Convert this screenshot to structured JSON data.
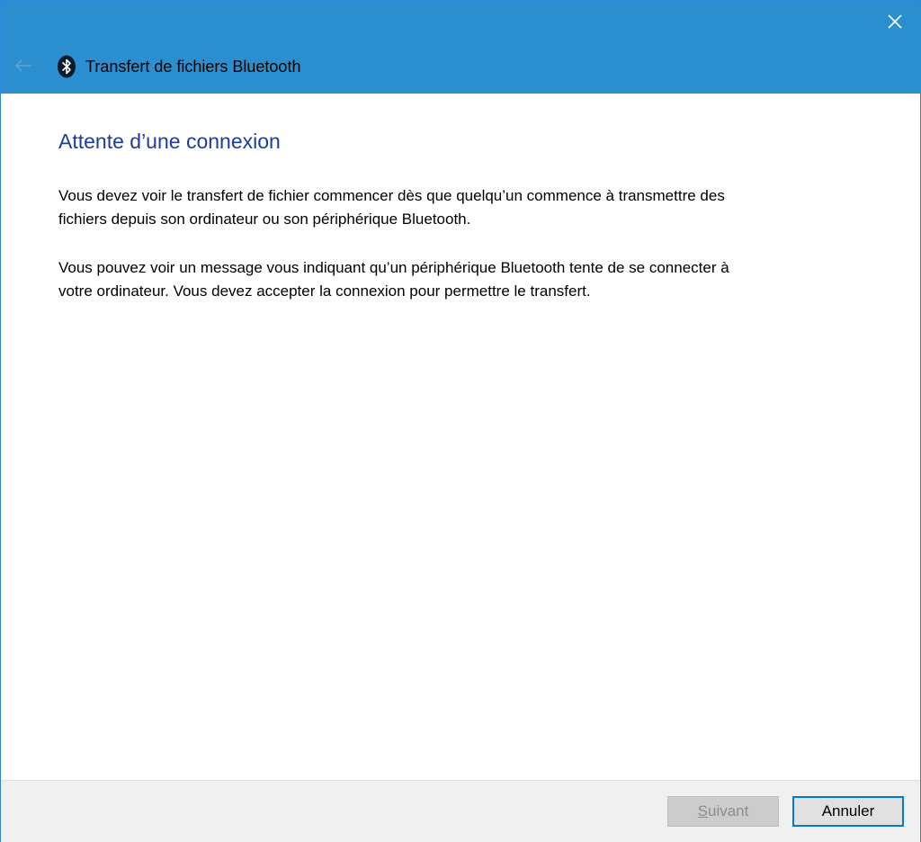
{
  "window": {
    "title": "Transfert de fichiers Bluetooth",
    "accent_color": "#2b8fcf",
    "close_icon": "close-icon",
    "back_icon": "back-arrow-icon",
    "app_icon": "bluetooth-icon"
  },
  "main": {
    "heading": "Attente d’une connexion",
    "paragraph1": "Vous devez voir le transfert de fichier commencer dès que quelqu’un commence à transmettre des fichiers depuis son ordinateur ou son périphérique Bluetooth.",
    "paragraph2": "Vous pouvez voir un message vous indiquant qu’un périphérique Bluetooth tente de se connecter à votre ordinateur. Vous devez accepter la connexion pour permettre le transfert."
  },
  "footer": {
    "next_label_first": "S",
    "next_label_rest": "uivant",
    "next_enabled": false,
    "cancel_label": "Annuler"
  }
}
